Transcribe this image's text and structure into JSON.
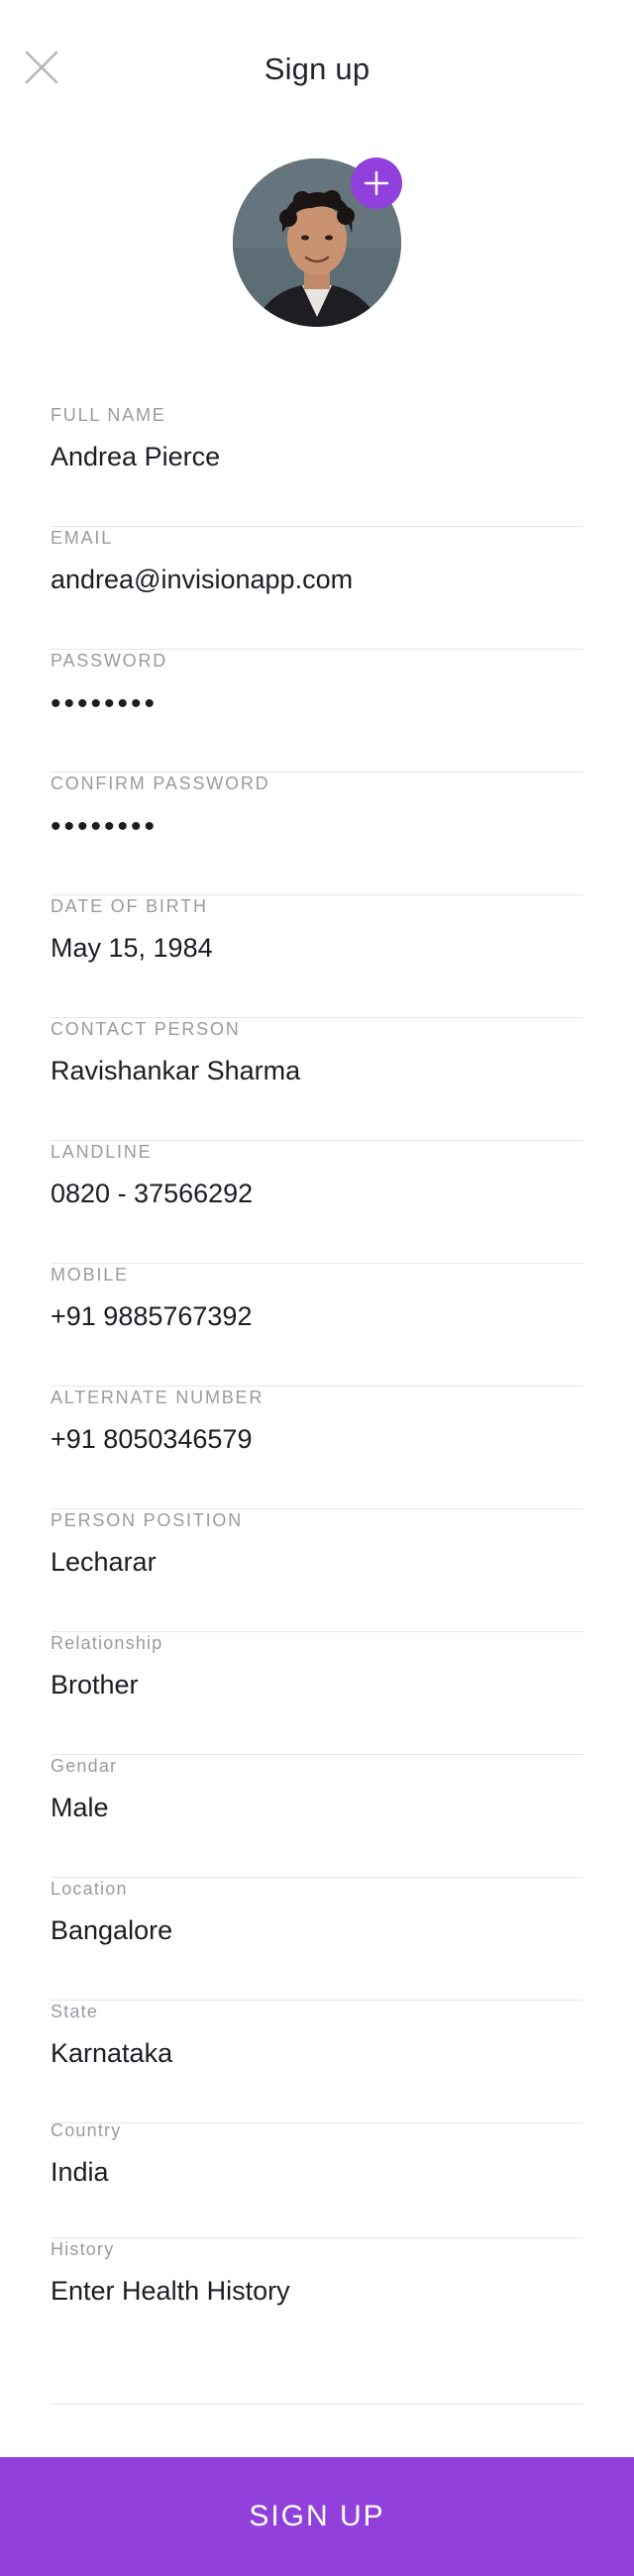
{
  "header": {
    "title": "Sign up",
    "close_icon": "close-icon"
  },
  "profile": {
    "avatar_icon": "avatar-photo",
    "add_photo_icon": "plus-icon",
    "accent_color": "#9140dc"
  },
  "fields": [
    {
      "label": "FULL NAME",
      "value": "Andrea Pierce"
    },
    {
      "label": "EMAIL",
      "value": "andrea@invisionapp.com"
    },
    {
      "label": "PASSWORD",
      "value": "••••••••"
    },
    {
      "label": "CONFIRM PASSWORD",
      "value": "••••••••"
    },
    {
      "label": "DATE OF BIRTH",
      "value": "May 15, 1984"
    },
    {
      "label": "CONTACT PERSON",
      "value": "Ravishankar Sharma"
    },
    {
      "label": "LANDLINE",
      "value": "0820 - 37566292"
    },
    {
      "label": "MOBILE",
      "value": "+91 9885767392"
    },
    {
      "label": "ALTERNATE NUMBER",
      "value": "+91 8050346579"
    },
    {
      "label": "PERSON POSITION",
      "value": "Lecharar"
    },
    {
      "label": "Relationship",
      "value": "Brother"
    },
    {
      "label": "Gendar",
      "value": "Male"
    },
    {
      "label": "Location",
      "value": "Bangalore"
    },
    {
      "label": "State",
      "value": "Karnataka"
    },
    {
      "label": "Country",
      "value": "India"
    },
    {
      "label": "History",
      "value": "Enter Health History"
    }
  ],
  "footer": {
    "signup_label": "SIGN UP",
    "button_color": "#9140dc"
  }
}
